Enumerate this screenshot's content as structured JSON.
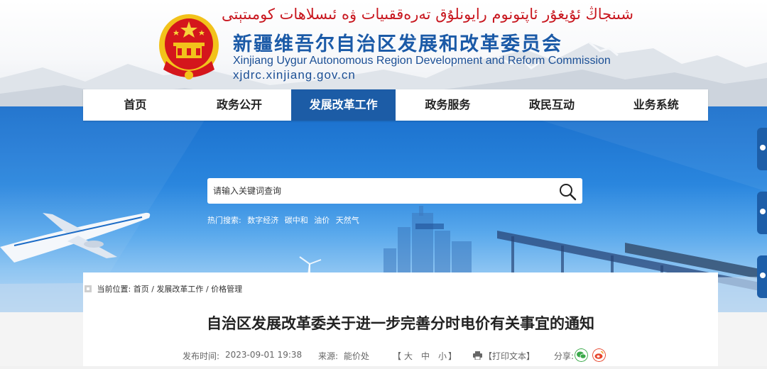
{
  "header": {
    "uyghur_title": "شىنجاڭ ئۇيغۇر ئاپتونوم رايونلۇق تەرەققىيات ۋە ئىسلاھات كومىتېتى",
    "title_cn": "新疆维吾尔自治区发展和改革委员会",
    "title_en": "Xinjiang Uygur Autonomous Region Development and Reform Commission",
    "url": "xjdrc.xinjiang.gov.cn",
    "emblem_icon": "national-emblem-icon"
  },
  "nav": {
    "items": [
      {
        "label": "首页"
      },
      {
        "label": "政务公开"
      },
      {
        "label": "发展改革工作"
      },
      {
        "label": "政务服务"
      },
      {
        "label": "政民互动"
      },
      {
        "label": "业务系统"
      }
    ],
    "active_index": 2
  },
  "search": {
    "placeholder": "请输入关键词查询",
    "hot_label": "热门搜索:",
    "hot_keywords": [
      "数字经济",
      "碳中和",
      "油价",
      "天然气"
    ]
  },
  "breadcrumb": {
    "label": "当前位置:",
    "items": [
      "首页",
      "发展改革工作",
      "价格管理"
    ],
    "separator": "/"
  },
  "article": {
    "title": "自治区发展改革委关于进一步完善分时电价有关事宜的通知",
    "publish_label": "发布时间:",
    "publish_time": "2023-09-01 19:38",
    "source_label": "来源:",
    "source": "能价处",
    "font_open": "【",
    "font_large": "大",
    "font_medium": "中",
    "font_small": "小",
    "font_close": "】",
    "print_label": "【打印文本】",
    "share_label": "分享:"
  },
  "colors": {
    "brand_blue": "#1c5ca6",
    "title_red": "#c8161e",
    "wechat_green": "#3aa94a",
    "weibo_orange": "#e6452c"
  }
}
